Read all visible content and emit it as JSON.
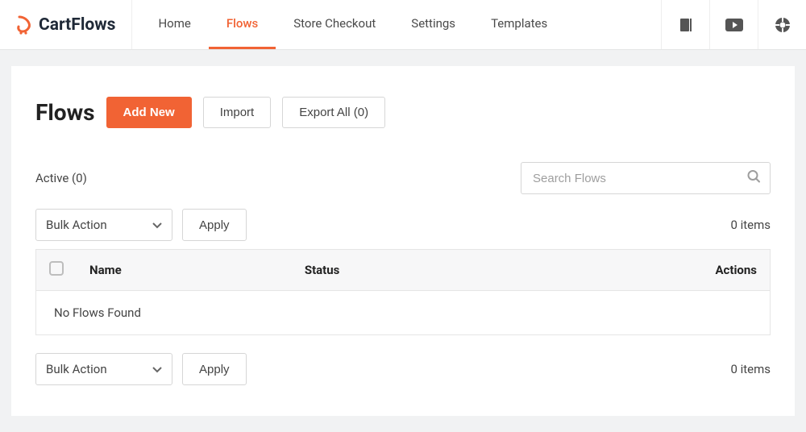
{
  "brand": {
    "name": "CartFlows"
  },
  "nav": {
    "items": [
      {
        "label": "Home",
        "active": false
      },
      {
        "label": "Flows",
        "active": true
      },
      {
        "label": "Store Checkout",
        "active": false
      },
      {
        "label": "Settings",
        "active": false
      },
      {
        "label": "Templates",
        "active": false
      }
    ]
  },
  "page": {
    "title": "Flows",
    "add_new": "Add New",
    "import": "Import",
    "export_all": "Export All (0)",
    "filter_active": "Active (0)",
    "search_placeholder": "Search Flows",
    "bulk_action": "Bulk Action",
    "apply": "Apply",
    "items_count": "0 items",
    "table": {
      "col_name": "Name",
      "col_status": "Status",
      "col_actions": "Actions"
    },
    "empty": "No Flows Found"
  }
}
